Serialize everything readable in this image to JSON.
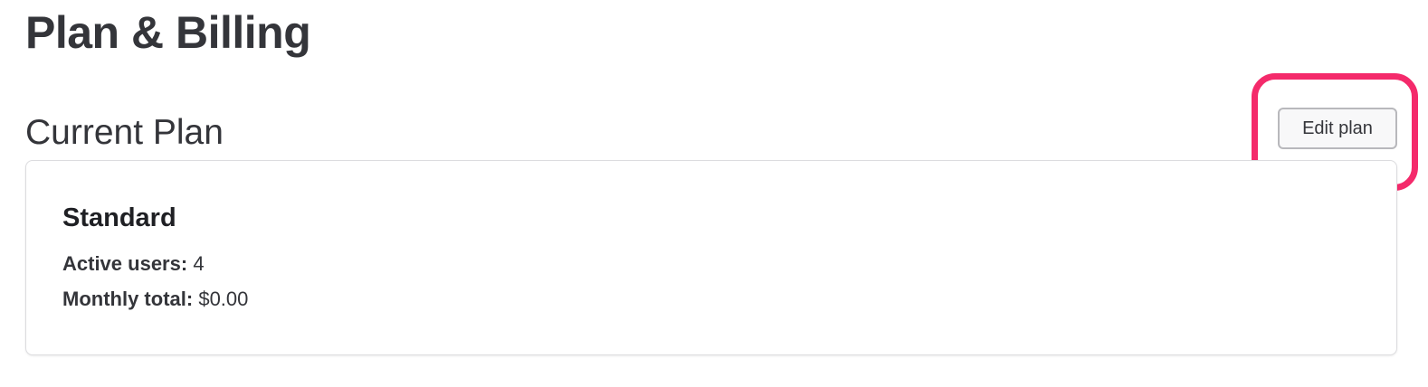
{
  "page": {
    "title": "Plan & Billing"
  },
  "current_plan": {
    "section_title": "Current Plan",
    "edit_button_label": "Edit plan",
    "plan_name": "Standard",
    "active_users_label": "Active users:",
    "active_users_value": "4",
    "monthly_total_label": "Monthly total:",
    "monthly_total_value": "$0.00"
  },
  "colors": {
    "text": "#34353a",
    "highlight": "#f42a6b",
    "card_border": "#dcdcdf"
  }
}
